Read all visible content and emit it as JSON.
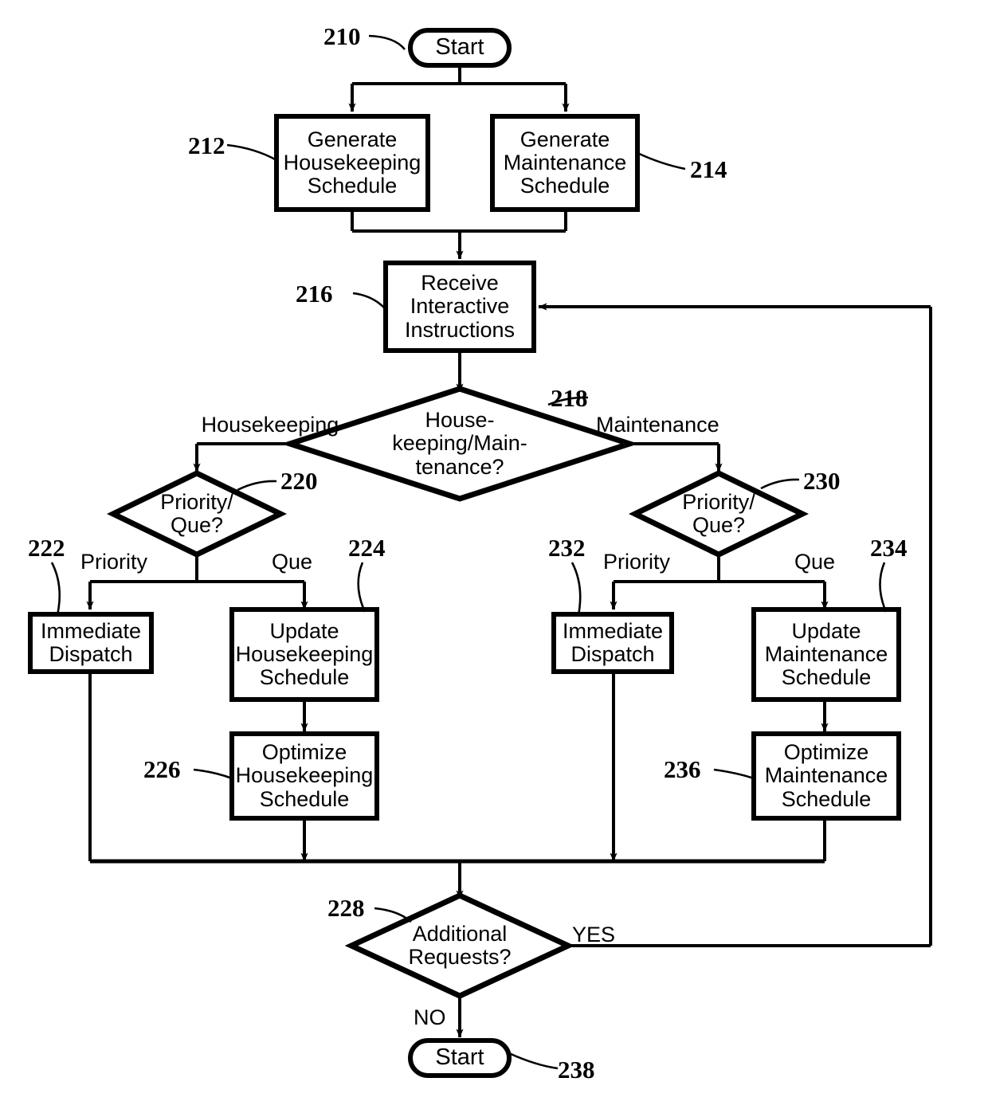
{
  "diagram": {
    "type": "flowchart",
    "title": "Housekeeping and Maintenance Scheduling Flowchart",
    "nodes": [
      {
        "id": "210",
        "ref": "210",
        "shape": "terminator",
        "label": "Start"
      },
      {
        "id": "212",
        "ref": "212",
        "shape": "process",
        "label": "Generate\nHousekeeping\nSchedule"
      },
      {
        "id": "214",
        "ref": "214",
        "shape": "process",
        "label": "Generate\nMaintenance\nSchedule"
      },
      {
        "id": "216",
        "ref": "216",
        "shape": "process",
        "label": "Receive\nInteractive\nInstructions"
      },
      {
        "id": "218",
        "ref": "218",
        "shape": "decision",
        "label": "House-\nkeeping/Main-\ntenance?"
      },
      {
        "id": "220",
        "ref": "220",
        "shape": "decision",
        "label": "Priority/\nQue?"
      },
      {
        "id": "222",
        "ref": "222",
        "shape": "process",
        "label": "Immediate\nDispatch"
      },
      {
        "id": "224",
        "ref": "224",
        "shape": "process",
        "label": "Update\nHousekeeping\nSchedule"
      },
      {
        "id": "226",
        "ref": "226",
        "shape": "process",
        "label": "Optimize\nHousekeeping\nSchedule"
      },
      {
        "id": "228",
        "ref": "228",
        "shape": "decision",
        "label": "Additional\nRequests?"
      },
      {
        "id": "230",
        "ref": "230",
        "shape": "decision",
        "label": "Priority/\nQue?"
      },
      {
        "id": "232",
        "ref": "232",
        "shape": "process",
        "label": "Immediate\nDispatch"
      },
      {
        "id": "234",
        "ref": "234",
        "shape": "process",
        "label": "Update\nMaintenance\nSchedule"
      },
      {
        "id": "236",
        "ref": "236",
        "shape": "process",
        "label": "Optimize\nMaintenance\nSchedule"
      },
      {
        "id": "238",
        "ref": "238",
        "shape": "terminator",
        "label": "Start"
      }
    ],
    "edge_labels": {
      "housekeeping": "Housekeeping",
      "maintenance": "Maintenance",
      "priority_left": "Priority",
      "que_left": "Que",
      "priority_right": "Priority",
      "que_right": "Que",
      "yes": "YES",
      "no": "NO"
    },
    "reference_numerals": {
      "n210": "210",
      "n212": "212",
      "n214": "214",
      "n216": "216",
      "n218": "218",
      "n220": "220",
      "n222": "222",
      "n224": "224",
      "n226": "226",
      "n228": "228",
      "n230": "230",
      "n232": "232",
      "n234": "234",
      "n236": "236",
      "n238": "238"
    },
    "colors": {
      "stroke": "#000000",
      "fill": "#ffffff",
      "text": "#000000"
    }
  }
}
